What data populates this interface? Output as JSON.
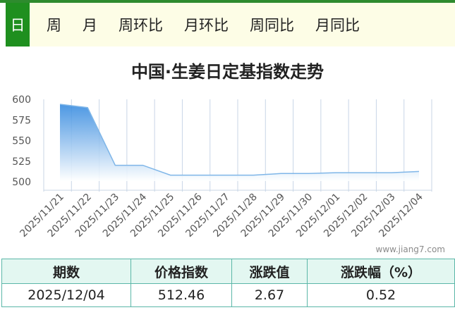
{
  "tabs": [
    {
      "label": "日",
      "active": true
    },
    {
      "label": "周"
    },
    {
      "label": "月"
    },
    {
      "label": "周环比"
    },
    {
      "label": "月环比"
    },
    {
      "label": "周同比"
    },
    {
      "label": "月同比"
    }
  ],
  "chart_title": "中国·生姜日定基指数走势",
  "watermark": "www.jiang7.com",
  "chart_data": {
    "type": "area",
    "title": "中国·生姜日定基指数走势",
    "categories": [
      "2025/11/21",
      "2025/11/22",
      "2025/11/23",
      "2025/11/24",
      "2025/11/25",
      "2025/11/26",
      "2025/11/27",
      "2025/11/28",
      "2025/11/29",
      "2025/11/30",
      "2025/12/01",
      "2025/12/02",
      "2025/12/03",
      "2025/12/04"
    ],
    "series": [
      {
        "values": [
          594,
          590,
          520,
          520,
          508,
          508,
          508,
          508,
          510,
          510,
          511,
          511,
          511,
          512.46
        ]
      }
    ],
    "y_ticks": [
      "600",
      "575",
      "550",
      "525",
      "500"
    ],
    "ylim": [
      500,
      600
    ],
    "grid": "vertical",
    "colors": {
      "line": "#7fb6e8",
      "fill_top": "#2e86de",
      "fill_bottom": "#ffffff"
    }
  },
  "table": {
    "headers": [
      "期数",
      "价格指数",
      "涨跌值",
      "涨跌幅（%）"
    ],
    "row": [
      "2025/12/04",
      "512.46",
      "2.67",
      "0.52"
    ]
  }
}
